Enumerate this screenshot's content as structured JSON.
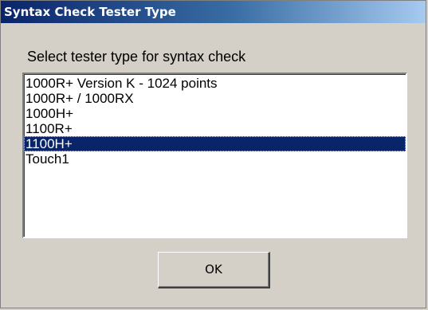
{
  "window": {
    "title": "Syntax Check Tester Type"
  },
  "prompt_label": "Select tester type for syntax check",
  "tester_list": {
    "items": [
      "1000R+ Version K - 1024 points",
      "1000R+ / 1000RX",
      "1000H+",
      "1100R+",
      "1100H+",
      "Touch1"
    ],
    "selected": "1100H+"
  },
  "ok_button": {
    "label": "OK"
  },
  "colors": {
    "dialog_face": "#d4d0c8",
    "titlebar_start": "#0a246a",
    "titlebar_end": "#a6caf0",
    "selection": "#0a246a"
  }
}
